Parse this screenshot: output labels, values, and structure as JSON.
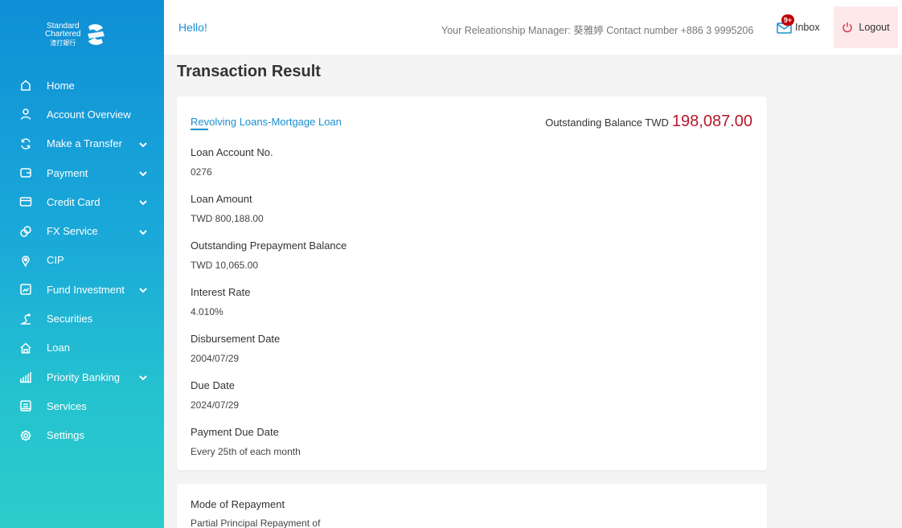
{
  "brand": {
    "line1": "Standard",
    "line2": "Chartered",
    "line3": "渣打銀行"
  },
  "sidebar": {
    "items": [
      {
        "label": "Home",
        "icon": "home-icon",
        "chevron": false
      },
      {
        "label": "Account Overview",
        "icon": "user-icon",
        "chevron": false
      },
      {
        "label": "Make a Transfer",
        "icon": "transfer-icon",
        "chevron": true
      },
      {
        "label": "Payment",
        "icon": "wallet-icon",
        "chevron": true
      },
      {
        "label": "Credit Card",
        "icon": "credit-card-icon",
        "chevron": true
      },
      {
        "label": "FX Service",
        "icon": "fx-icon",
        "chevron": true
      },
      {
        "label": "CIP",
        "icon": "cip-icon",
        "chevron": false
      },
      {
        "label": "Fund Investment",
        "icon": "chart-icon",
        "chevron": true
      },
      {
        "label": "Securities",
        "icon": "securities-icon",
        "chevron": false
      },
      {
        "label": "Loan",
        "icon": "house-icon",
        "chevron": false
      },
      {
        "label": "Priority Banking",
        "icon": "priority-icon",
        "chevron": true
      },
      {
        "label": "Services",
        "icon": "services-icon",
        "chevron": false
      },
      {
        "label": "Settings",
        "icon": "gear-icon",
        "chevron": false
      }
    ]
  },
  "header": {
    "greeting": "Hello!",
    "rm_text": "Your Releationship Manager: 葵雅婷 Contact number +886 3 9995206",
    "inbox_label": "Inbox",
    "inbox_badge": "9+",
    "logout_label": "Logout"
  },
  "page": {
    "title": "Transaction Result"
  },
  "loan": {
    "title": "Revolving Loans-Mortgage Loan",
    "balance_label": "Outstanding Balance TWD",
    "balance_value": "198,087.00",
    "fields": [
      {
        "label": "Loan Account No.",
        "value": "0276"
      },
      {
        "label": "Loan Amount",
        "value": "TWD 800,188.00"
      },
      {
        "label": "Outstanding Prepayment Balance",
        "value": "TWD 10,065.00"
      },
      {
        "label": "Interest Rate",
        "value": "4.010%"
      },
      {
        "label": "Disbursement Date",
        "value": "2004/07/29"
      },
      {
        "label": "Due Date",
        "value": "2024/07/29"
      },
      {
        "label": "Payment Due Date",
        "value": "Every 25th of each month"
      }
    ]
  },
  "repayment": {
    "label": "Mode of Repayment",
    "value": "Partial Principal Repayment of"
  },
  "colors": {
    "accent": "#1a8fd1",
    "balance": "#b3182b",
    "logout_bg": "#fde8ea"
  }
}
